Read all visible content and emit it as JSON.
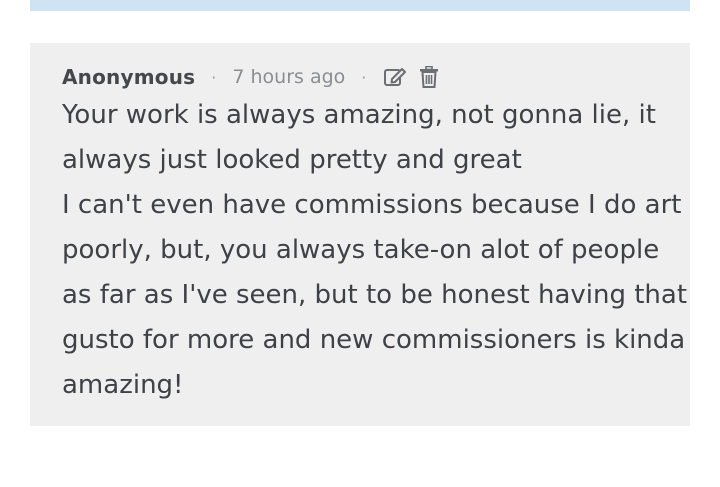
{
  "comment": {
    "author": "Anonymous",
    "separator": "·",
    "timestamp": "7 hours ago",
    "actions": {
      "edit_icon": "edit-icon",
      "delete_icon": "trash-icon"
    },
    "body_lines": [
      "Your work is always amazing, not gonna lie, it",
      "always just looked pretty and great",
      "I can't even have commissions because I do art",
      "poorly, but, you always take-on alot of people",
      "as far as I've seen, but to be honest having that",
      "gusto for more and new commissioners is kinda",
      "amazing!"
    ]
  },
  "colors": {
    "top_bar": "#cfe3f3",
    "card_background": "#efeff0",
    "author_text": "#44484d",
    "meta_text": "#8a8d91",
    "body_text": "#3e4146",
    "icon": "#6b6e72"
  }
}
